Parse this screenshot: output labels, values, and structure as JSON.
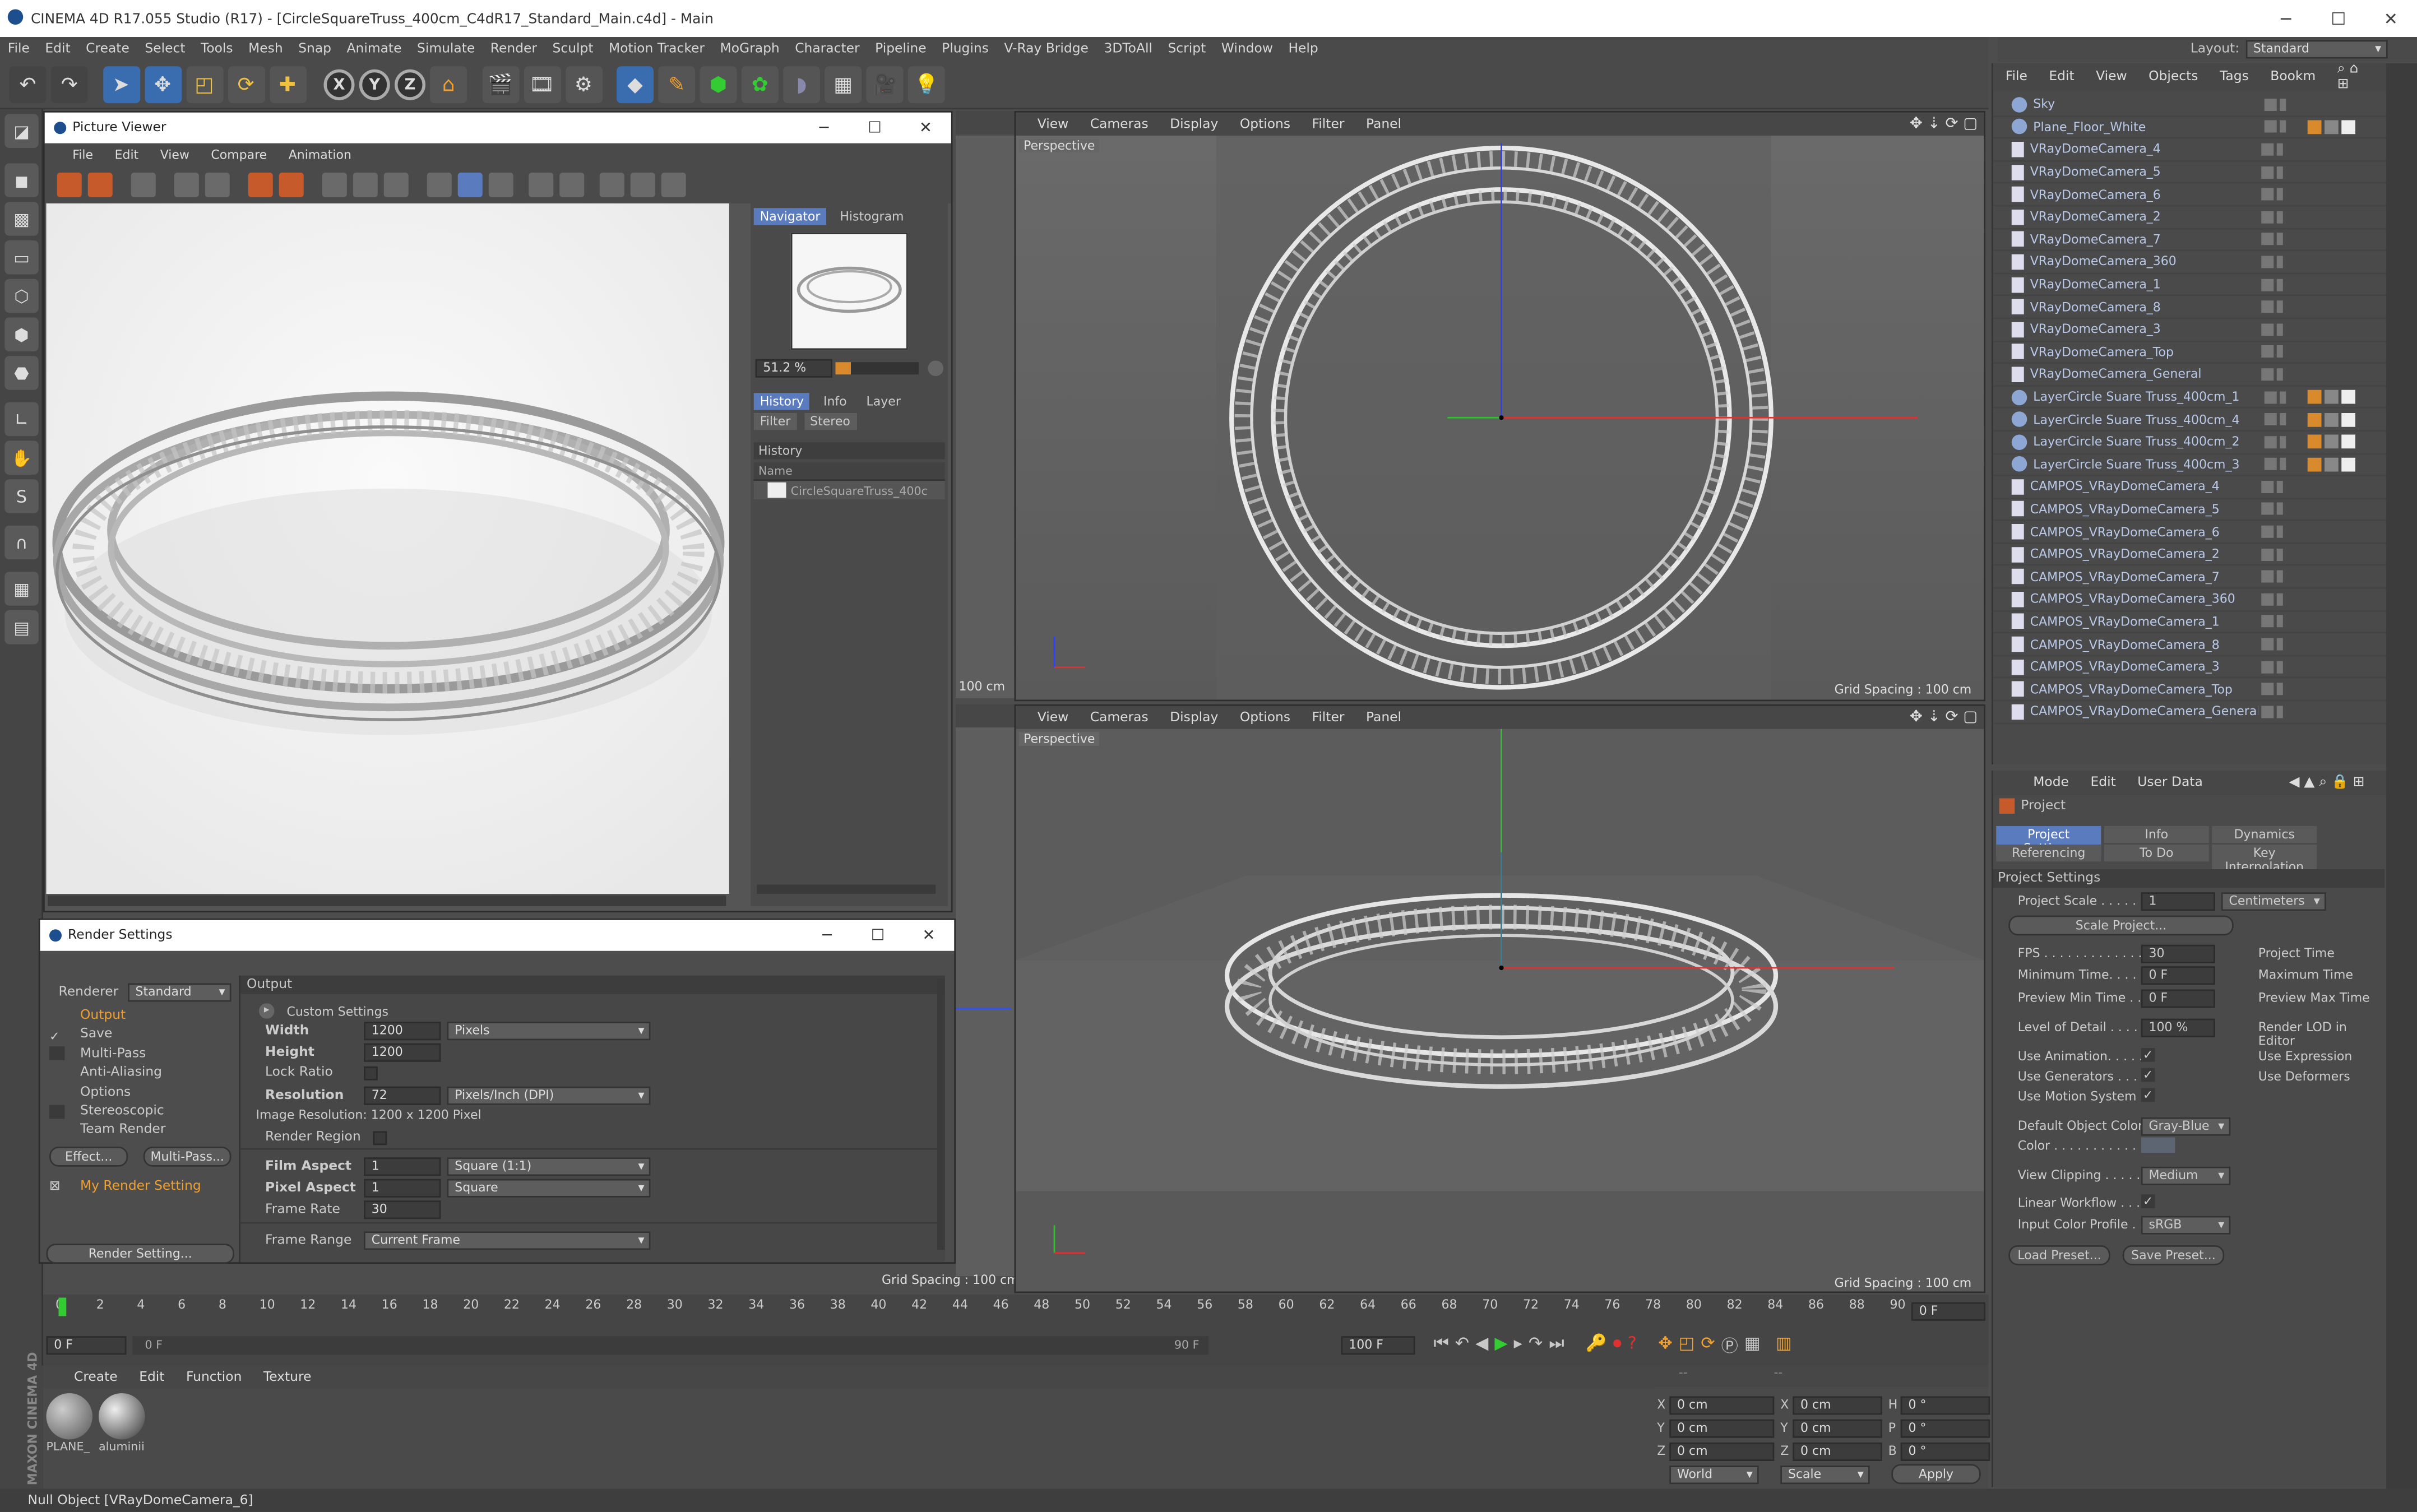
{
  "window": {
    "title": "CINEMA 4D R17.055 Studio (R17) - [CircleSquareTruss_400cm_C4dR17_Standard_Main.c4d] - Main"
  },
  "main_menu": [
    "File",
    "Edit",
    "Create",
    "Select",
    "Tools",
    "Mesh",
    "Snap",
    "Animate",
    "Simulate",
    "Render",
    "Sculpt",
    "Motion Tracker",
    "MoGraph",
    "Character",
    "Pipeline",
    "Plugins",
    "V-Ray Bridge",
    "3DToAll",
    "Script",
    "Window",
    "Help"
  ],
  "layout": {
    "label": "Layout:",
    "value": "Standard"
  },
  "toolbar_axes": [
    "X",
    "Y",
    "Z"
  ],
  "picture_viewer": {
    "title": "Picture Viewer",
    "menu": [
      "File",
      "Edit",
      "View",
      "Compare",
      "Animation"
    ],
    "tabs_top": [
      "Navigator",
      "Histogram"
    ],
    "zoom": "51.2 %",
    "tabs_mid": [
      "History",
      "Info",
      "Layer"
    ],
    "tabs_mid2": [
      "Filter",
      "Stereo"
    ],
    "history_header": "History",
    "history_col": "Name",
    "history_item": "CircleSquareTruss_400c"
  },
  "render_settings": {
    "title": "Render Settings",
    "renderer_label": "Renderer",
    "renderer_value": "Standard",
    "list": [
      "Output",
      "Save",
      "Multi-Pass",
      "Anti-Aliasing",
      "Options",
      "Stereoscopic",
      "Team Render"
    ],
    "effect_btn": "Effect...",
    "multipass_btn": "Multi-Pass...",
    "setting_name": "My Render Setting",
    "render_setting_btn": "Render Setting...",
    "section": "Output",
    "custom": "Custom Settings",
    "width_label": "Width",
    "width": "1200",
    "width_unit": "Pixels",
    "height_label": "Height",
    "height": "1200",
    "lock_ratio": "Lock Ratio",
    "resolution_label": "Resolution",
    "resolution": "72",
    "resolution_unit": "Pixels/Inch (DPI)",
    "image_res": "Image Resolution: 1200 x 1200 Pixel",
    "render_region": "Render Region",
    "film_aspect_label": "Film Aspect",
    "film_aspect": "1",
    "film_aspect_dd": "Square (1:1)",
    "pixel_aspect_label": "Pixel Aspect",
    "pixel_aspect": "1",
    "pixel_aspect_dd": "Square",
    "frame_rate_label": "Frame Rate",
    "frame_rate": "30",
    "frame_range_label": "Frame Range",
    "frame_range": "Current Frame"
  },
  "viewport": {
    "menu": [
      "View",
      "Cameras",
      "Display",
      "Options",
      "Filter",
      "Panel"
    ],
    "label": "Perspective",
    "grid": "Grid Spacing : 100 cm",
    "left_grid": "100 cm",
    "left_grid2": "Grid Spacing : 100 cm"
  },
  "object_manager": {
    "menu": [
      "File",
      "Edit",
      "View",
      "Objects",
      "Tags",
      "Bookm"
    ],
    "objects": [
      "Sky",
      "Plane_Floor_White",
      "VRayDomeCamera_4",
      "VRayDomeCamera_5",
      "VRayDomeCamera_6",
      "VRayDomeCamera_2",
      "VRayDomeCamera_7",
      "VRayDomeCamera_360",
      "VRayDomeCamera_1",
      "VRayDomeCamera_8",
      "VRayDomeCamera_3",
      "VRayDomeCamera_Top",
      "VRayDomeCamera_General",
      "LayerCircle Suare Truss_400cm_1",
      "LayerCircle Suare Truss_400cm_4",
      "LayerCircle Suare Truss_400cm_2",
      "LayerCircle Suare Truss_400cm_3",
      "CAMPOS_VRayDomeCamera_4",
      "CAMPOS_VRayDomeCamera_5",
      "CAMPOS_VRayDomeCamera_6",
      "CAMPOS_VRayDomeCamera_2",
      "CAMPOS_VRayDomeCamera_7",
      "CAMPOS_VRayDomeCamera_360",
      "CAMPOS_VRayDomeCamera_1",
      "CAMPOS_VRayDomeCamera_8",
      "CAMPOS_VRayDomeCamera_3",
      "CAMPOS_VRayDomeCamera_Top",
      "CAMPOS_VRayDomeCamera_General"
    ]
  },
  "attributes": {
    "menu": [
      "Mode",
      "Edit",
      "User Data"
    ],
    "object": "Project",
    "tabs": [
      "Project Settings",
      "Info",
      "Dynamics",
      "Referencing",
      "To Do",
      "Key Interpolation"
    ],
    "section": "Project Settings",
    "project_scale_label": "Project Scale . . . . . .",
    "project_scale": "1",
    "project_scale_unit": "Centimeters",
    "scale_project_btn": "Scale Project...",
    "fps_label": "FPS . . . . . . . . . . . . . .",
    "fps": "30",
    "project_time": "Project Time",
    "min_time_label": "Minimum Time. . . . . .",
    "min_time": "0 F",
    "max_time": "Maximum Time",
    "prev_min_label": "Preview Min Time . . .",
    "prev_min": "0 F",
    "prev_max": "Preview Max Time",
    "lod_label": "Level of Detail . . . . .",
    "lod": "100 %",
    "render_lod": "Render LOD in Editor",
    "use_anim": "Use Animation. . . . . .",
    "use_expr": "Use Expression",
    "use_gen": "Use Generators . . . . .",
    "use_def": "Use Deformers",
    "use_motion": "Use Motion System",
    "def_color_label": "Default Object Color",
    "def_color": "Gray-Blue",
    "color_label": "Color . . . . . . . . . . . .",
    "clipping_label": "View Clipping . . . . . .",
    "clipping": "Medium",
    "linear_wf": "Linear Workflow . . . . .",
    "input_profile_label": "Input Color Profile . . .",
    "input_profile": "sRGB",
    "load_preset": "Load Preset...",
    "save_preset": "Save Preset..."
  },
  "timeline": {
    "ticks": [
      "0",
      "2",
      "4",
      "6",
      "8",
      "10",
      "12",
      "14",
      "16",
      "18",
      "20",
      "22",
      "24",
      "26",
      "28",
      "30",
      "32",
      "34",
      "36",
      "38",
      "40",
      "42",
      "44",
      "46",
      "48",
      "50",
      "52",
      "54",
      "56",
      "58",
      "60",
      "62",
      "64",
      "66",
      "68",
      "70",
      "72",
      "74",
      "76",
      "78",
      "80",
      "82",
      "84",
      "86",
      "88",
      "90"
    ],
    "current": "0 F",
    "start": "0 F",
    "slider_start": "0 F",
    "slider_end": "90 F",
    "end": "100 F",
    "frame_display": "0 F"
  },
  "materials": {
    "menu": [
      "Create",
      "Edit",
      "Function",
      "Texture"
    ],
    "items": [
      "PLANE_",
      "aluminii"
    ]
  },
  "coords": {
    "x": "0 cm",
    "y": "0 cm",
    "z": "0 cm",
    "sx": "0 cm",
    "sy": "0 cm",
    "sz": "0 cm",
    "h": "0 °",
    "p": "0 °",
    "b": "0 °",
    "world": "World",
    "scale": "Scale",
    "apply": "Apply"
  },
  "status": "Null Object [VRayDomeCamera_6]",
  "logo": "MAXON CINEMA 4D"
}
